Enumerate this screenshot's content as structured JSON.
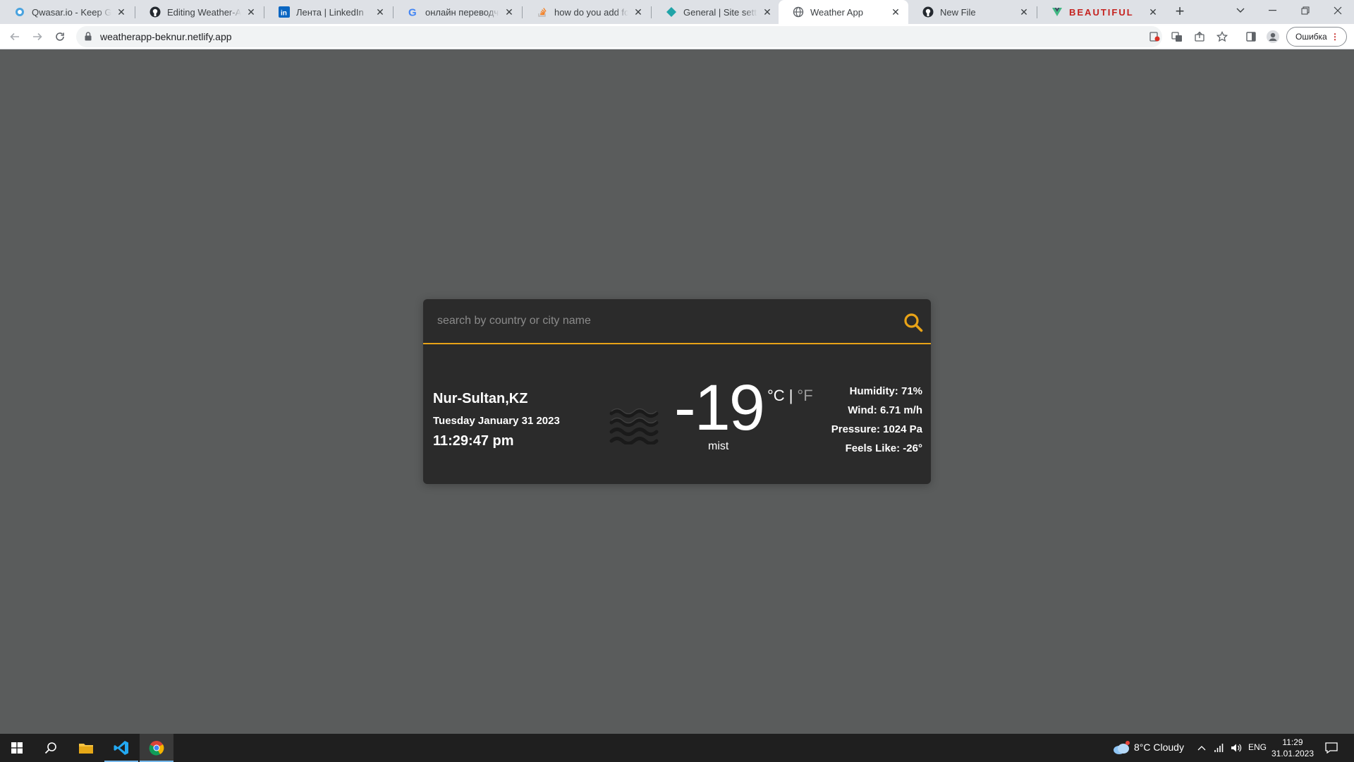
{
  "browser": {
    "tabs": [
      {
        "title": "Qwasar.io - Keep Growing",
        "icon": "qwasar-icon"
      },
      {
        "title": "Editing Weather-App/README.md",
        "icon": "github-icon"
      },
      {
        "title": "Лента | LinkedIn",
        "icon": "linkedin-icon"
      },
      {
        "title": "онлайн переводчик - Google Search",
        "icon": "google-icon"
      },
      {
        "title": "how do you add footer",
        "icon": "stackoverflow-icon"
      },
      {
        "title": "General | Site settings",
        "icon": "netlify-icon"
      },
      {
        "title": "Weather App",
        "icon": "globe-icon",
        "active": true
      },
      {
        "title": "New File",
        "icon": "github-icon"
      },
      {
        "title": "BEAUTIFUL",
        "icon": "vue-icon"
      }
    ],
    "url": "weatherapp-beknur.netlify.app",
    "profile_label": "Ошибка"
  },
  "weather": {
    "search_placeholder": "search by country or city name",
    "city": "Nur-Sultan,KZ",
    "date": "Tuesday January 31 2023",
    "time": "11:29:47 pm",
    "temperature": "-19",
    "unit_c": "°C",
    "unit_sep": "|",
    "unit_f": "°F",
    "description": "mist",
    "icon": "mist-icon",
    "humidity": "Humidity: 71%",
    "wind": "Wind: 6.71 m/h",
    "pressure": "Pressure: 1024 Pa",
    "feels_like": "Feels Like: -26°",
    "accent_color": "#e8a317"
  },
  "taskbar": {
    "weather_text": "8°C  Cloudy",
    "language": "ENG",
    "time": "11:29",
    "date": "31.01.2023"
  }
}
